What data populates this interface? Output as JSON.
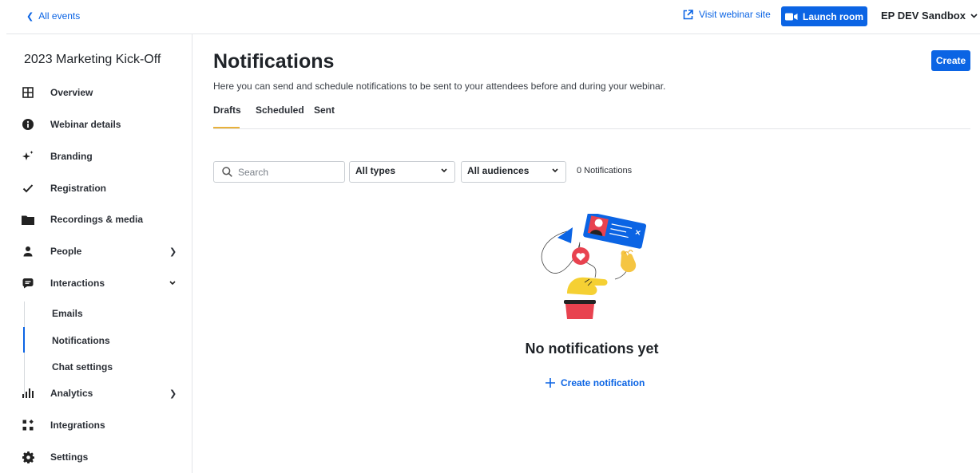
{
  "topbar": {
    "back_label": "All events",
    "visit_label": "Visit webinar site",
    "launch_label": "Launch room",
    "org_label": "EP DEV Sandbox"
  },
  "sidebar": {
    "event_title": "2023 Marketing Kick-Off",
    "items": [
      {
        "label": "Overview",
        "icon": "grid-icon"
      },
      {
        "label": "Webinar details",
        "icon": "info-icon"
      },
      {
        "label": "Branding",
        "icon": "sparkle-icon"
      },
      {
        "label": "Registration",
        "icon": "check-icon"
      },
      {
        "label": "Recordings & media",
        "icon": "folder-icon"
      },
      {
        "label": "People",
        "icon": "person-icon"
      },
      {
        "label": "Interactions",
        "icon": "chat-icon"
      },
      {
        "label": "Analytics",
        "icon": "bar-chart-icon"
      },
      {
        "label": "Integrations",
        "icon": "integrations-icon"
      },
      {
        "label": "Settings",
        "icon": "gear-icon"
      }
    ],
    "sub_items": [
      {
        "label": "Emails"
      },
      {
        "label": "Notifications"
      },
      {
        "label": "Chat settings"
      }
    ]
  },
  "main": {
    "title": "Notifications",
    "description": "Here you can send and schedule notifications to be sent to your attendees before and during your webinar.",
    "create_label": "Create",
    "tabs": [
      {
        "label": "Drafts"
      },
      {
        "label": "Scheduled"
      },
      {
        "label": "Sent"
      }
    ],
    "active_tab": "Drafts",
    "search": {
      "placeholder": "Search",
      "value": ""
    },
    "type_filter": "All types",
    "audience_filter": "All audiences",
    "count_label": "0 Notifications",
    "empty_title": "No notifications yet",
    "create_notification_label": "Create notification"
  },
  "colors": {
    "accent": "#0b64e4",
    "tab_underline": "#e8b13b",
    "heart": "#e8424f",
    "hand": "#f5d033"
  }
}
